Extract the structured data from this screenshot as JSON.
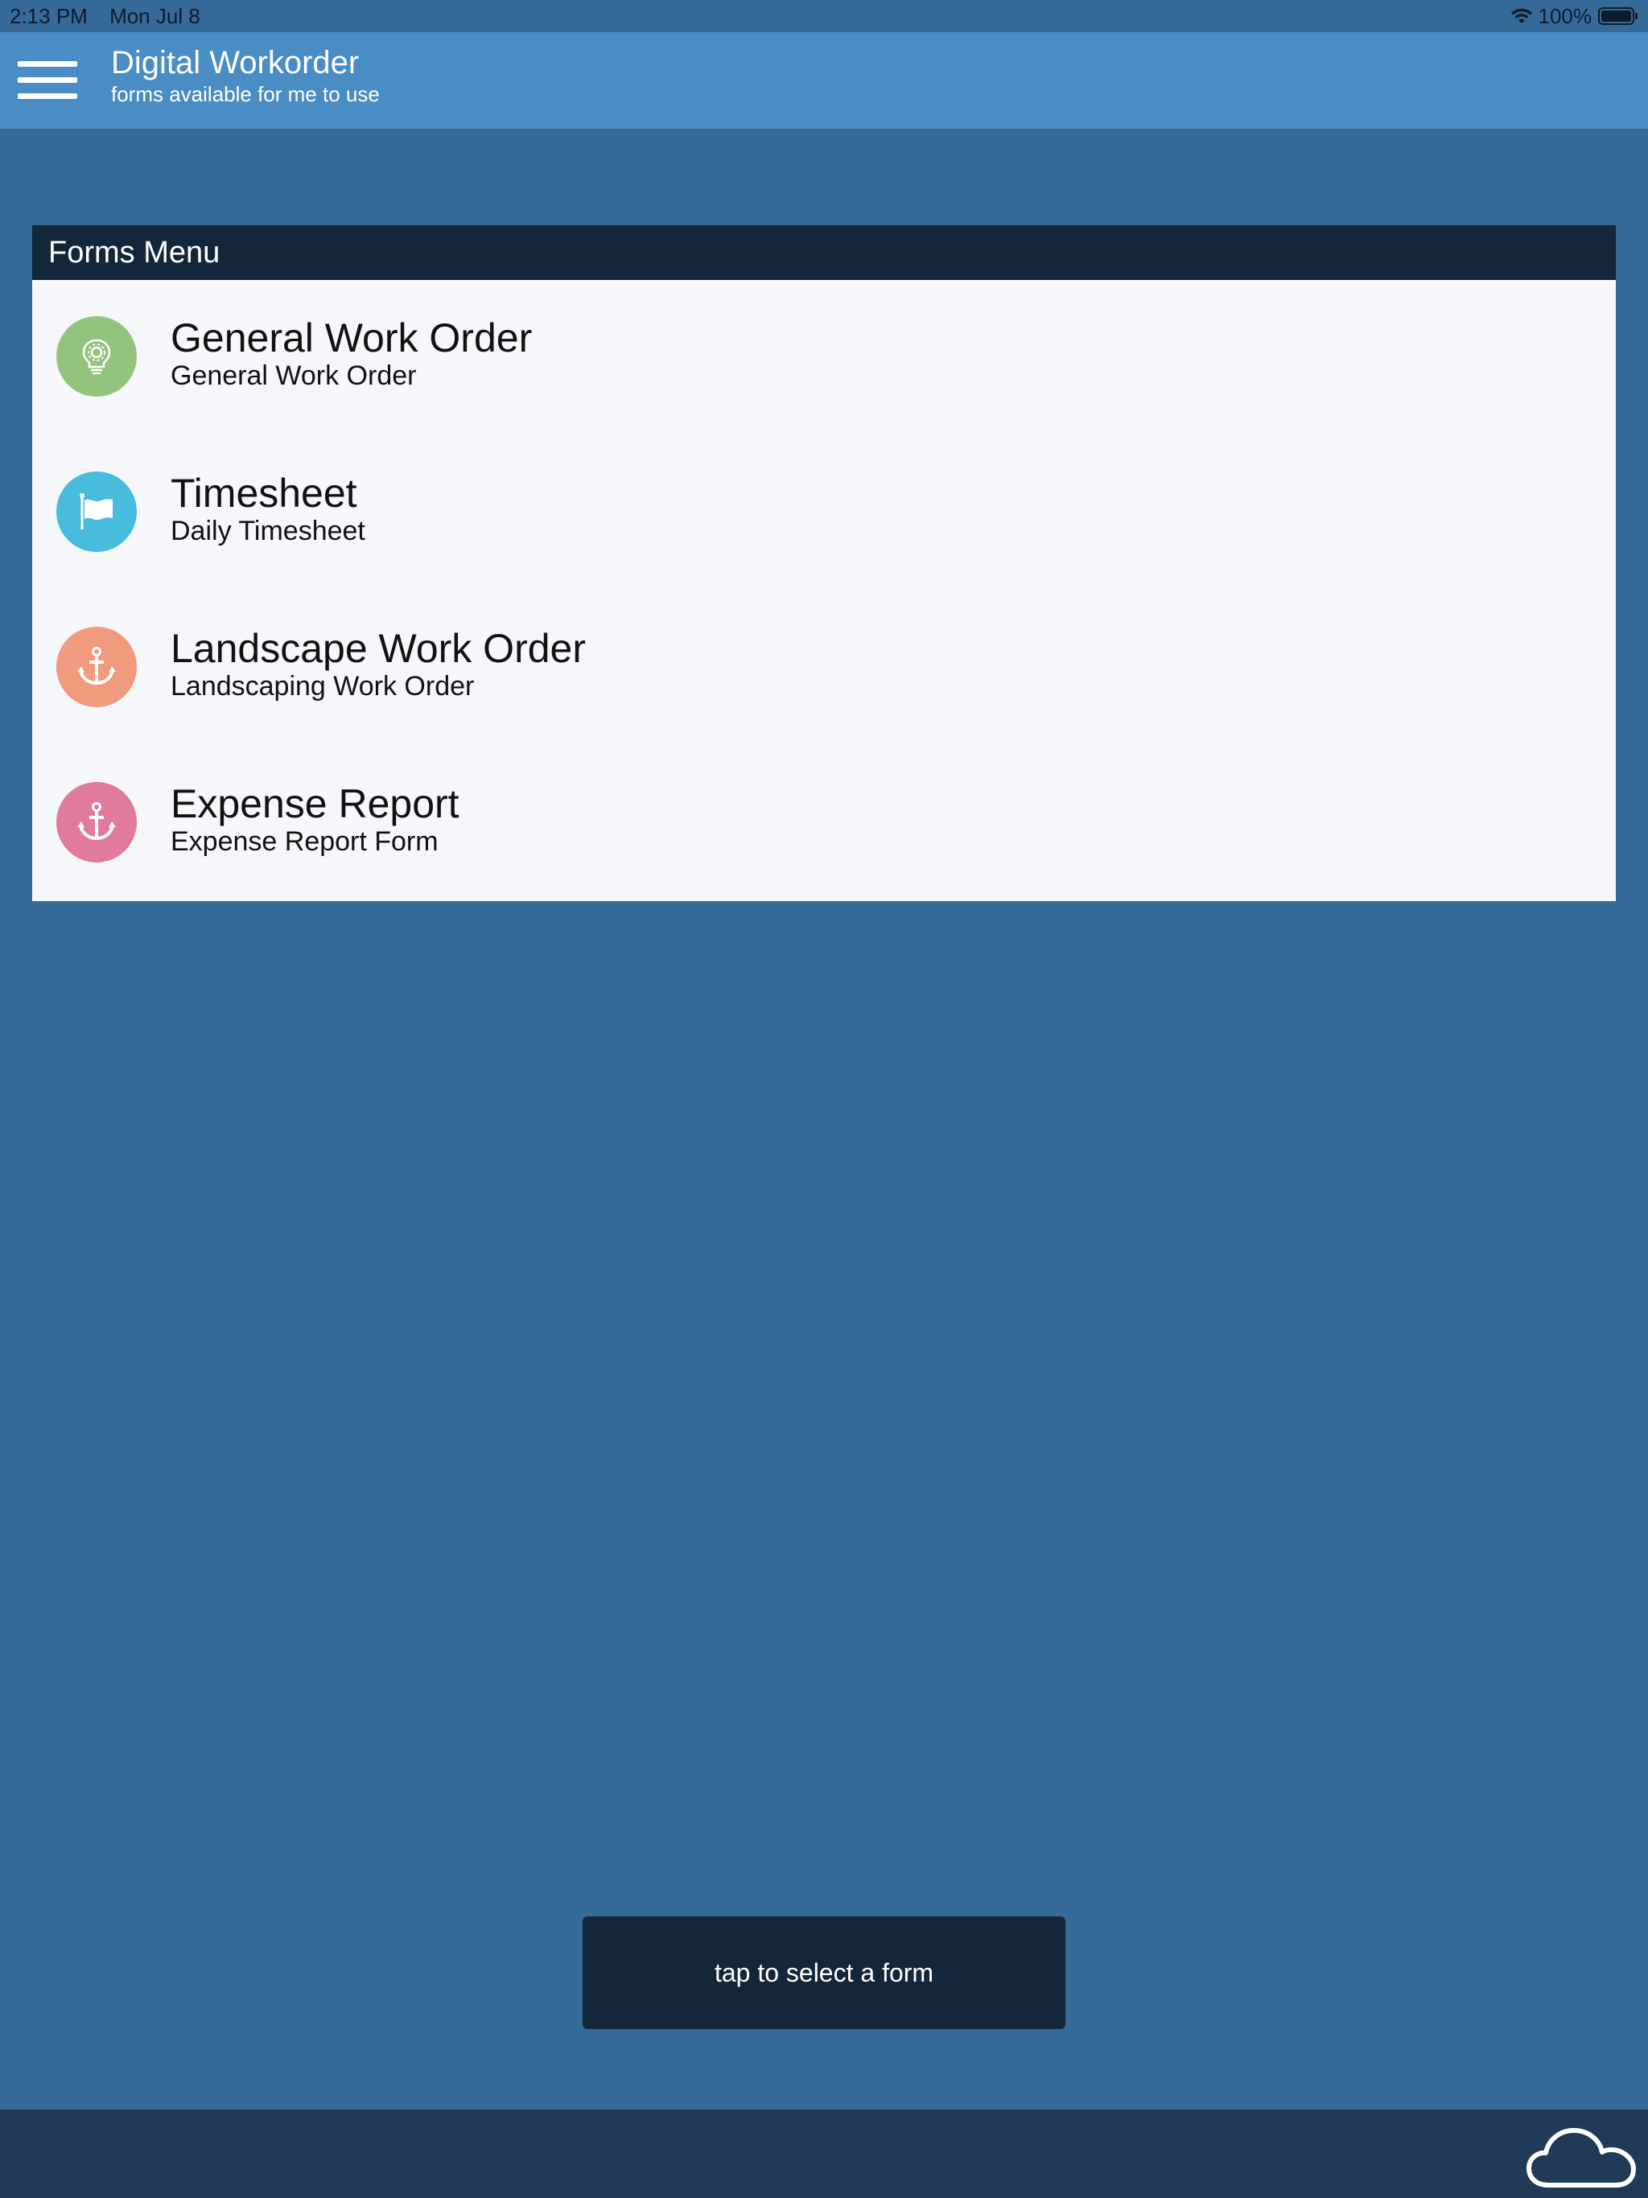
{
  "status_bar": {
    "time": "2:13 PM",
    "date": "Mon Jul 8",
    "battery": "100%",
    "icons": [
      "wifi-icon",
      "battery-icon"
    ]
  },
  "header": {
    "title": "Digital Workorder",
    "subtitle": "forms available for me to use",
    "menu_icon": "hamburger-menu-icon"
  },
  "forms_menu": {
    "title": "Forms Menu",
    "items": [
      {
        "title": "General Work Order",
        "subtitle": "General Work Order",
        "icon": "lightbulb-gear-icon",
        "color": "#93c47d"
      },
      {
        "title": "Timesheet",
        "subtitle": "Daily Timesheet",
        "icon": "flag-icon",
        "color": "#48bcdc"
      },
      {
        "title": "Landscape Work Order",
        "subtitle": "Landscaping Work Order",
        "icon": "anchor-icon",
        "color": "#f09a7e"
      },
      {
        "title": "Expense Report",
        "subtitle": "Expense Report Form",
        "icon": "anchor-icon",
        "color": "#e07b9b"
      }
    ]
  },
  "action": {
    "label": "tap to select a form"
  },
  "footer": {
    "icon": "cloud-icon"
  },
  "colors": {
    "background": "#356a99",
    "header": "#4a8cc4",
    "dark": "#14263a",
    "bottom_bar": "#1f3b57",
    "panel": "#f5f7fb"
  }
}
